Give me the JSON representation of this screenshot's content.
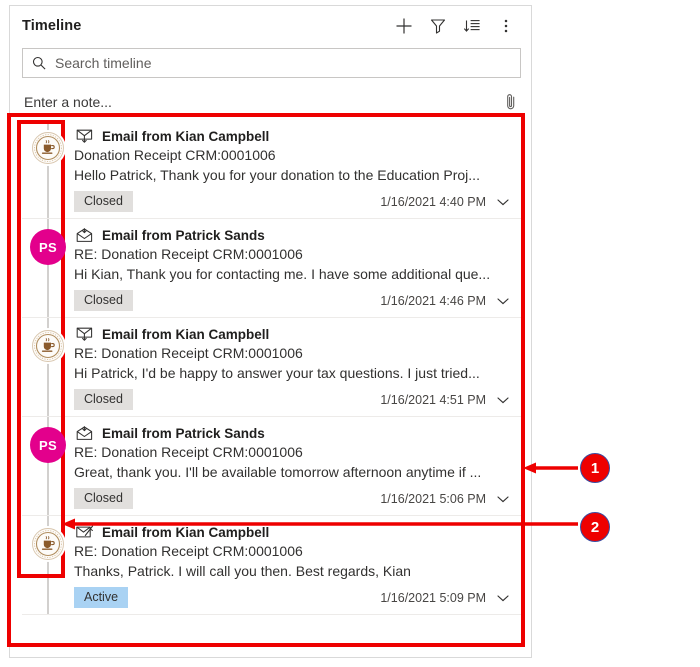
{
  "panel": {
    "title": "Timeline",
    "header_actions": [
      {
        "name": "add",
        "label": "Add",
        "icon": "plus-icon"
      },
      {
        "name": "filter",
        "label": "Filter",
        "icon": "funnel-icon"
      },
      {
        "name": "sort",
        "label": "Sort",
        "icon": "sort-descending-icon"
      },
      {
        "name": "more",
        "label": "More commands",
        "icon": "more-vertical-icon"
      }
    ]
  },
  "search": {
    "placeholder": "Search timeline",
    "value": "",
    "icon": "search-icon"
  },
  "note": {
    "placeholder": "Enter a note...",
    "value": "",
    "attach_icon": "paperclip-icon"
  },
  "entries": [
    {
      "avatar_type": "logo",
      "avatar_label": "",
      "message_icon": "email-received-icon",
      "title": "Email from Kian Campbell",
      "subject": "Donation Receipt CRM:0001006",
      "preview": "Hello Patrick,   Thank you for your donation to the Education Proj...",
      "status": "Closed",
      "status_kind": "closed",
      "timestamp": "1/16/2021 4:40 PM",
      "expand_icon": "chevron-down-icon"
    },
    {
      "avatar_type": "initials",
      "avatar_label": "PS",
      "message_icon": "email-open-icon",
      "title": "Email from Patrick Sands",
      "subject": "RE: Donation Receipt CRM:0001006",
      "preview": "Hi Kian, Thank you for contacting me. I have some additional que...",
      "status": "Closed",
      "status_kind": "closed",
      "timestamp": "1/16/2021 4:46 PM",
      "expand_icon": "chevron-down-icon"
    },
    {
      "avatar_type": "logo",
      "avatar_label": "",
      "message_icon": "email-received-icon",
      "title": "Email from Kian Campbell",
      "subject": "RE: Donation Receipt CRM:0001006",
      "preview": "Hi Patrick,   I'd be happy to answer your tax questions. I just tried...",
      "status": "Closed",
      "status_kind": "closed",
      "timestamp": "1/16/2021 4:51 PM",
      "expand_icon": "chevron-down-icon"
    },
    {
      "avatar_type": "initials",
      "avatar_label": "PS",
      "message_icon": "email-open-icon",
      "title": "Email from Patrick Sands",
      "subject": "RE: Donation Receipt CRM:0001006",
      "preview": "Great, thank you. I'll be available tomorrow afternoon anytime if ...",
      "status": "Closed",
      "status_kind": "closed",
      "timestamp": "1/16/2021 5:06 PM",
      "expand_icon": "chevron-down-icon"
    },
    {
      "avatar_type": "logo",
      "avatar_label": "",
      "message_icon": "email-draft-icon",
      "title": "Email from Kian Campbell",
      "subject": "RE: Donation Receipt CRM:0001006",
      "preview": "Thanks, Patrick. I will call you then.   Best regards, Kian",
      "status": "Active",
      "status_kind": "active",
      "timestamp": "1/16/2021 5:09 PM",
      "expand_icon": "chevron-down-icon"
    }
  ],
  "annotations": {
    "color": "#ee0000",
    "callouts": [
      {
        "label": "1",
        "target": "timeline-entries-outline"
      },
      {
        "label": "2",
        "target": "timeline-rail-outline"
      }
    ]
  },
  "colors": {
    "accent_pink": "#e3008c",
    "badge_closed": "#e1dfdd",
    "badge_active": "#a9d2f3",
    "annotation_red": "#ee0000"
  }
}
